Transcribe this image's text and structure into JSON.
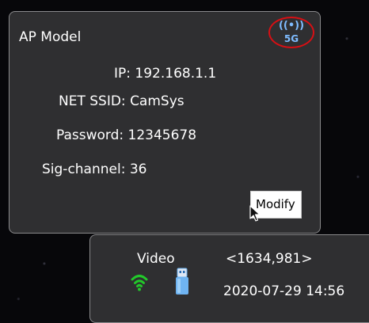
{
  "ap_panel": {
    "title": "AP Model",
    "signal_badge": {
      "waves": "((•))",
      "band": "5G",
      "icon": "wifi-signal-icon",
      "color": "#7fbcff",
      "highlight_color": "#d80f14"
    },
    "fields": {
      "ip": "IP: 192.168.1.1",
      "ssid": "NET SSID: CamSys",
      "password": "Password: 12345678",
      "channel": "Sig-channel: 36"
    },
    "modify_label": "Modify"
  },
  "status_panel": {
    "video_label": "Video",
    "coordinates": "<1634,981>",
    "datetime": "2020-07-29 14:56",
    "wifi_icon": "wifi-icon",
    "wifi_color": "#22c92a",
    "usb_icon": "usb-drive-icon",
    "usb_color": "#6fb4f2"
  },
  "colors": {
    "panel_bg": "#2f2f31",
    "panel_border": "#8a8a8c",
    "text": "#ffffff"
  }
}
